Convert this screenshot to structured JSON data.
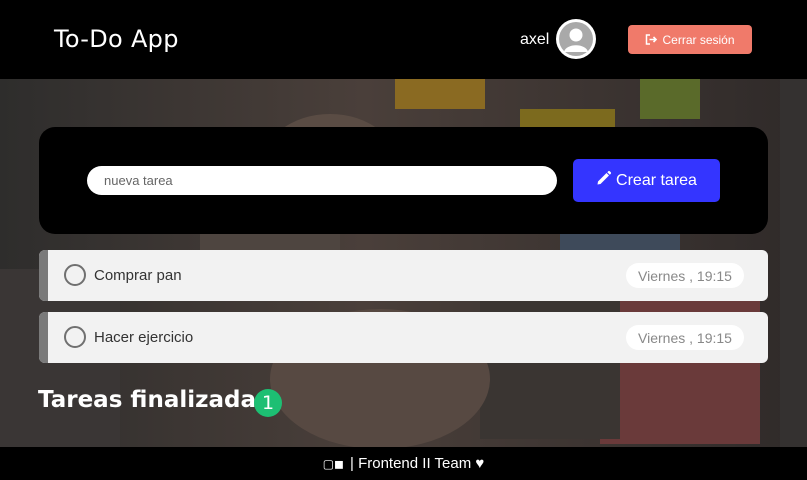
{
  "header": {
    "app_title": "To-Do App",
    "user_name": "axel",
    "logout_label": "Cerrar sesión",
    "logout_color": "#f07a6a"
  },
  "new_task": {
    "placeholder": "nueva tarea",
    "create_label": "Crear tarea",
    "create_color": "#3435ff"
  },
  "tasks": [
    {
      "description": "Comprar pan",
      "timestamp": "Viernes , 19:15"
    },
    {
      "description": "Hacer ejercicio",
      "timestamp": "Viernes , 19:15"
    }
  ],
  "finished": {
    "title": "Tareas finalizadas",
    "count": "1",
    "badge_color": "#1dbf73"
  },
  "footer": {
    "symbols": "▢◼",
    "text": "| Frontend II Team ♥"
  },
  "icons": {
    "avatar": "user-avatar-icon",
    "logout": "sign-out-icon",
    "create": "pencil-icon",
    "check": "empty-circle-icon"
  }
}
